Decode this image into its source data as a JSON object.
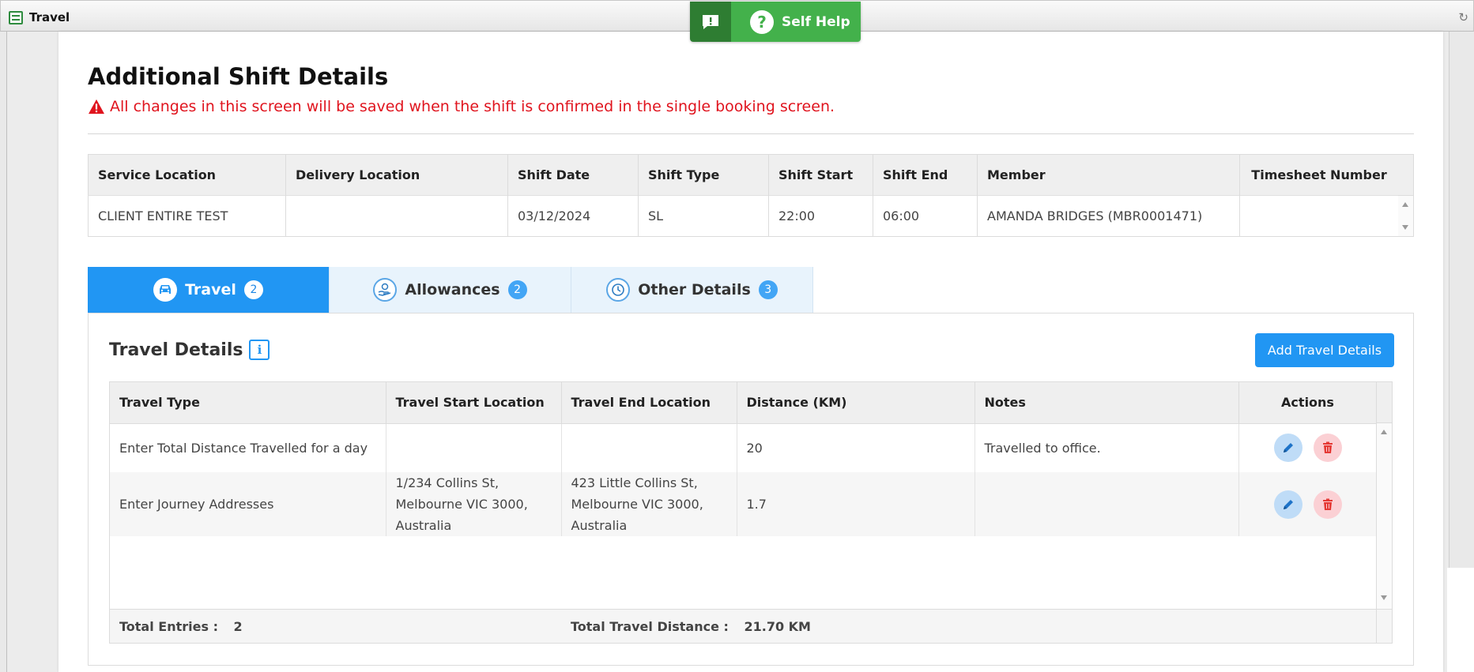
{
  "window": {
    "title": "Travel"
  },
  "self_help": {
    "label": "Self Help"
  },
  "page": {
    "title": "Additional Shift Details",
    "warning": "All changes in this screen will be saved when the shift is confirmed in the single booking screen."
  },
  "shift_table": {
    "headers": [
      "Service Location",
      "Delivery Location",
      "Shift Date",
      "Shift Type",
      "Shift Start",
      "Shift End",
      "Member",
      "Timesheet Number"
    ],
    "row": [
      "CLIENT ENTIRE TEST",
      "",
      "03/12/2024",
      "SL",
      "22:00",
      "06:00",
      "AMANDA BRIDGES (MBR0001471)",
      ""
    ]
  },
  "tabs": [
    {
      "label": "Travel",
      "count": "2",
      "icon": "car-icon",
      "active": true
    },
    {
      "label": "Allowances",
      "count": "2",
      "icon": "allowance-hand-icon",
      "active": false
    },
    {
      "label": "Other Details",
      "count": "3",
      "icon": "clock-icon",
      "active": false
    }
  ],
  "travel": {
    "section_title": "Travel Details",
    "add_button": "Add Travel Details",
    "headers": [
      "Travel Type",
      "Travel Start Location",
      "Travel End Location",
      "Distance (KM)",
      "Notes",
      "Actions"
    ],
    "rows": [
      {
        "type": "Enter Total Distance Travelled for a day",
        "start": "",
        "end": "",
        "distance": "20",
        "notes": "Travelled to office."
      },
      {
        "type": "Enter Journey Addresses",
        "start": "1/234 Collins St, Melbourne VIC 3000, Australia",
        "end": "423 Little Collins St, Melbourne VIC 3000, Australia",
        "distance": "1.7",
        "notes": ""
      }
    ],
    "footer": {
      "entries_label": "Total Entries :",
      "entries_value": "2",
      "distance_label": "Total Travel Distance :",
      "distance_value": "21.70 KM"
    }
  },
  "colors": {
    "primary": "#2196f3",
    "warning_text": "#e0141e",
    "self_help_green": "#43b14b",
    "self_help_dark": "#2e7d32",
    "edit_bg": "#bfdcf7",
    "delete_bg": "#fbd0d4"
  }
}
